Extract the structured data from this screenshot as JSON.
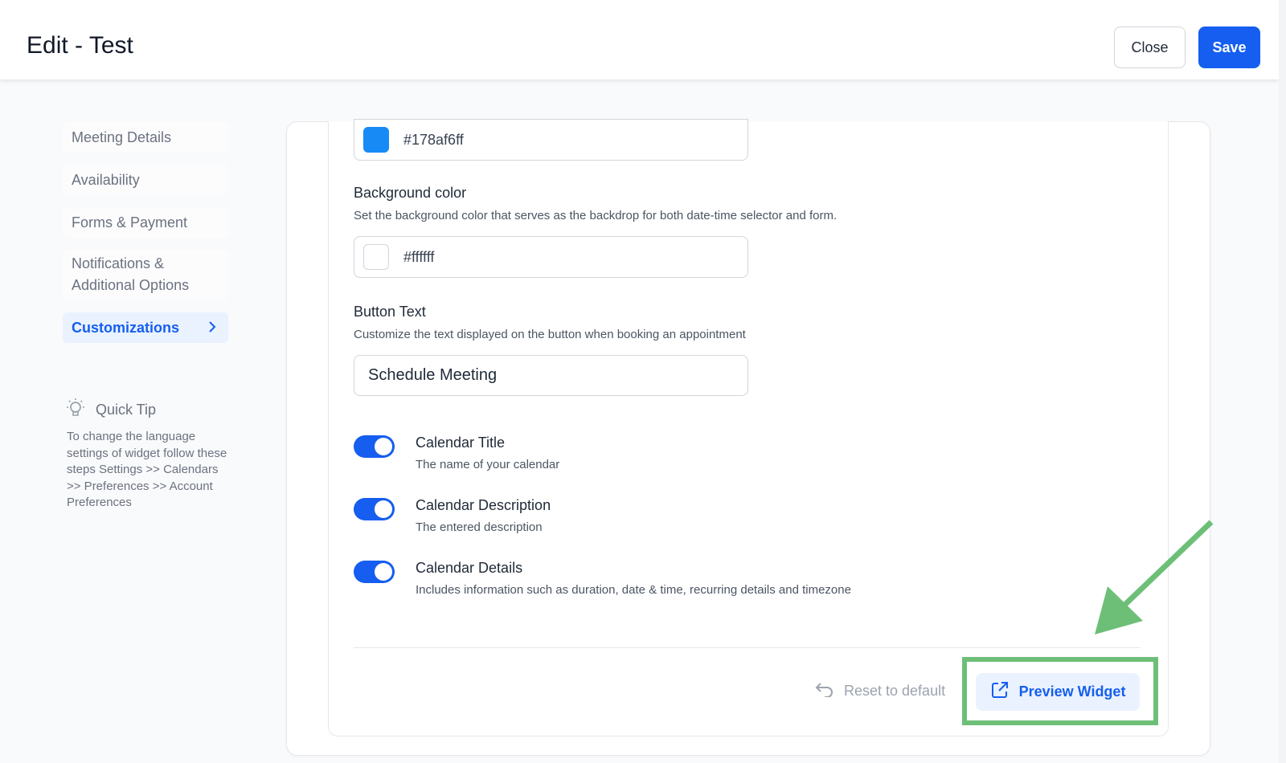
{
  "header": {
    "title": "Edit - Test",
    "close_label": "Close",
    "save_label": "Save"
  },
  "sidebar": {
    "items": [
      {
        "label": "Meeting Details"
      },
      {
        "label": "Availability"
      },
      {
        "label": "Forms & Payment"
      },
      {
        "label": "Notifications & Additional Options"
      },
      {
        "label": "Customizations",
        "active": true,
        "icon": "chevron-right-icon"
      }
    ],
    "quick_tip": {
      "title": "Quick Tip",
      "icon": "lightbulb-icon",
      "body": "To change the language settings of widget follow these steps Settings >> Calendars >> Preferences >> Account Preferences"
    }
  },
  "main": {
    "primary_color": {
      "value": "#178af6ff",
      "swatch": "#178af6"
    },
    "background_color": {
      "label": "Background color",
      "help": "Set the background color that serves as the backdrop for both date-time selector and form.",
      "value": "#ffffff",
      "swatch": "#ffffff"
    },
    "button_text": {
      "label": "Button Text",
      "help": "Customize the text displayed on the button when booking an appointment",
      "value": "Schedule Meeting"
    },
    "toggles": [
      {
        "title": "Calendar Title",
        "desc": "The name of your calendar",
        "on": true
      },
      {
        "title": "Calendar Description",
        "desc": "The entered description",
        "on": true
      },
      {
        "title": "Calendar Details",
        "desc": "Includes information such as duration, date & time, recurring details and timezone",
        "on": true
      }
    ],
    "reset_label": "Reset to default",
    "preview_label": "Preview Widget"
  },
  "colors": {
    "accent": "#155eef",
    "highlight": "#6dbf78"
  }
}
